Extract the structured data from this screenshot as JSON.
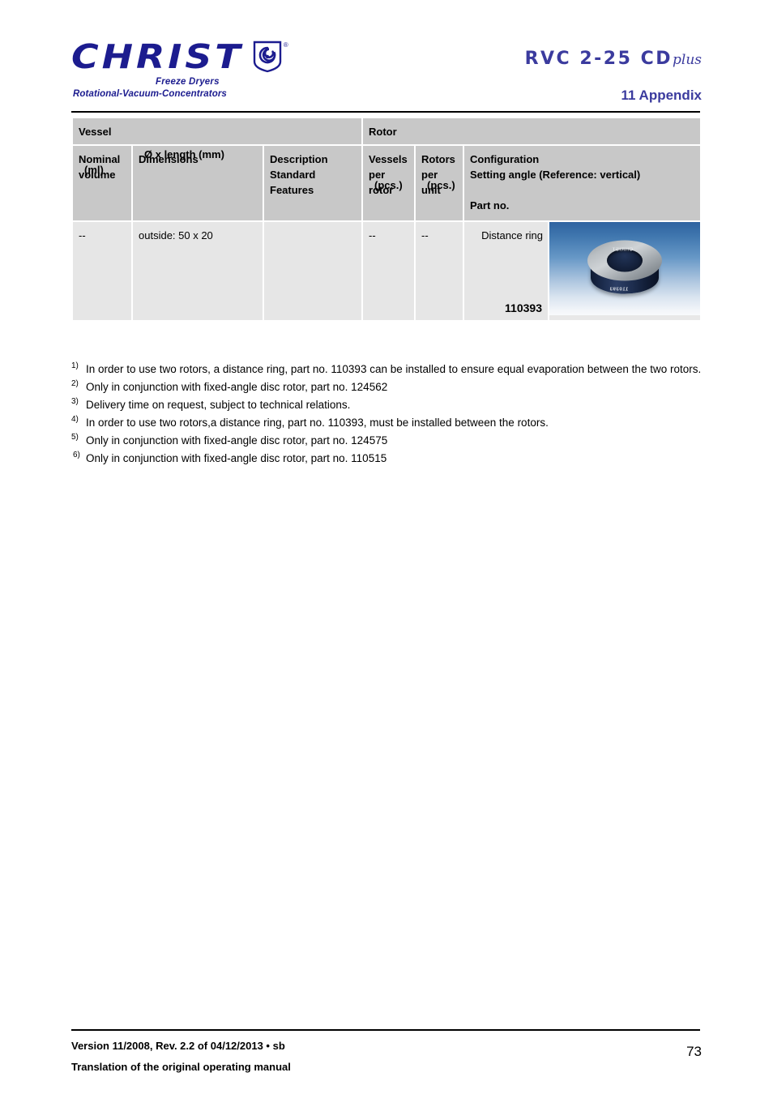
{
  "header": {
    "logo_wordmark": "CHRIST",
    "logo_registered": "®",
    "logo_tagline_1": "Freeze Dryers",
    "logo_tagline_2": "Rotational-Vacuum-Concentrators",
    "model_name": "RVC 2-25 CD",
    "model_suffix": "plus",
    "chapter_title": "11 Appendix",
    "brand_color": "#1c1c8f",
    "accent_color": "#3b3b9e"
  },
  "table": {
    "group_headers": [
      {
        "label": "Vessel"
      },
      {
        "label": "Rotor"
      }
    ],
    "column_headers": [
      {
        "lines": [
          "Nominal",
          "volume"
        ],
        "unit": "(ml)"
      },
      {
        "lines": [
          "Dimensions"
        ],
        "unit": "Ø x length (mm)"
      },
      {
        "lines": [
          "Description",
          "Standard",
          "Features"
        ],
        "unit": ""
      },
      {
        "lines": [
          "Vessels",
          "per",
          "rotor"
        ],
        "unit": "(pcs.)"
      },
      {
        "lines": [
          "Rotors",
          "per unit"
        ],
        "unit": "(pcs.)"
      },
      {
        "lines": [
          "Configuration",
          "Setting angle (Reference: vertical)",
          "",
          "Part no."
        ],
        "unit": ""
      }
    ],
    "rows": [
      {
        "nominal_volume": "--",
        "dimensions": "outside: 50 x 20",
        "description": "",
        "vessels_per_rotor": "--",
        "rotors_per_unit": "--",
        "configuration": "Distance ring",
        "part_no": "110393",
        "image": {
          "alt": "distance-ring-photo",
          "engraving_brand": "CHRIST",
          "engraving_part_no": "110393",
          "background_top_color": "#2f63a0",
          "background_bottom_color": "#ffffff"
        }
      }
    ],
    "header_bg_color": "#c8c8c8",
    "cell_bg_color": "#e6e6e6"
  },
  "footnotes": [
    {
      "marker": "1)",
      "text": "In order to use two rotors, a distance ring, part no. 110393 can be installed to ensure equal evaporation between the two rotors."
    },
    {
      "marker": "2)",
      "text": "Only in conjunction with fixed-angle disc rotor, part no. 124562"
    },
    {
      "marker": "3)",
      "text": "Delivery time on request, subject to technical relations."
    },
    {
      "marker": "4)",
      "text": "In order to use two rotors,a distance ring, part no. 110393, must be installed between the rotors."
    },
    {
      "marker": "5)",
      "text": "Only in conjunction with fixed-angle disc rotor, part no. 124575"
    },
    {
      "marker": "6)",
      "text": "Only in conjunction with fixed-angle disc rotor, part no. 110515"
    }
  ],
  "footer": {
    "version_line": "Version 11/2008, Rev. 2.2 of 04/12/2013 • sb",
    "translation_line": "Translation of the original operating manual",
    "page_number": "73"
  }
}
